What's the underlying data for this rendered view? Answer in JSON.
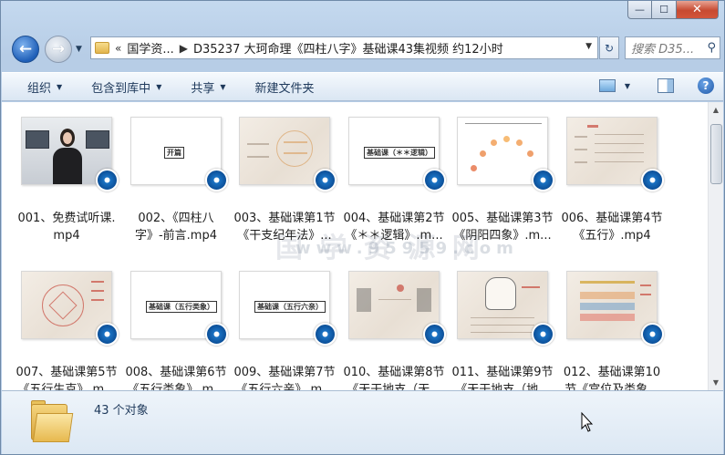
{
  "window": {
    "caption_buttons": {
      "minimize": "—",
      "maximize": "☐",
      "close": "✕"
    }
  },
  "nav": {
    "back_icon": "←",
    "forward_icon": "→",
    "overflow": "«",
    "crumbs": [
      "国学资...",
      "D35237 大珂命理《四柱八字》基础课43集视频 约12小时"
    ],
    "search_placeholder": "搜索 D35..."
  },
  "commandbar": {
    "organize": "组织",
    "include_library": "包含到库中",
    "share": "共享",
    "new_folder": "新建文件夹"
  },
  "files": [
    {
      "line1": "001、免费试听课.",
      "line2": "mp4",
      "thumb": "photo"
    },
    {
      "line1": "002、《四柱八",
      "line2": "字》-前言.mp4",
      "thumb": "white",
      "label": "开篇"
    },
    {
      "line1": "003、基础课第1节",
      "line2": "《干支纪年法》...",
      "thumb": "paper"
    },
    {
      "line1": "004、基础课第2节",
      "line2": "《＊＊逻辑》.m...",
      "thumb": "white",
      "label": "基础课（＊＊逻辑）"
    },
    {
      "line1": "005、基础课第3节",
      "line2": "《阴阳四象》.m...",
      "thumb": "white"
    },
    {
      "line1": "006、基础课第4节",
      "line2": "《五行》.mp4",
      "thumb": "paper"
    },
    {
      "line1": "007、基础课第5节",
      "line2": "《五行生克》.m...",
      "thumb": "paper"
    },
    {
      "line1": "008、基础课第6节",
      "line2": "《五行类象》.m...",
      "thumb": "white",
      "label": "基础课（五行类象）"
    },
    {
      "line1": "009、基础课第7节",
      "line2": "《五行六亲》.m...",
      "thumb": "white",
      "label": "基础课（五行六亲）"
    },
    {
      "line1": "010、基础课第8节",
      "line2": "《天干地支（天...",
      "thumb": "paper"
    },
    {
      "line1": "011、基础课第9节",
      "line2": "《天干地支（地...",
      "thumb": "paper"
    },
    {
      "line1": "012、基础课第10",
      "line2": "节《宫位及类象...",
      "thumb": "paper"
    }
  ],
  "watermark": "国 学 资 源 网",
  "watermark_url": "www.95959.com",
  "status": {
    "count": "43 个对象"
  },
  "colors": {
    "accent": "#1e395b",
    "badge": "#0c4f98",
    "close": "#c74a31"
  }
}
